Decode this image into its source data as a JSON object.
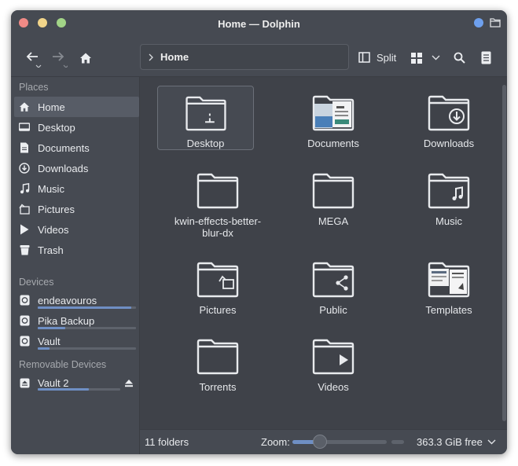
{
  "window": {
    "title": "Home — Dolphin"
  },
  "toolbar": {
    "back_icon": "arrow-left-icon",
    "forward_icon": "arrow-right-icon",
    "home_icon": "home-icon",
    "breadcrumb": [
      "Home"
    ],
    "split_label": "Split",
    "view_mode_icon": "grid-icon",
    "search_icon": "search-icon",
    "menu_icon": "hamburger-menu-icon"
  },
  "sidebar": {
    "places_title": "Places",
    "places": [
      {
        "label": "Home",
        "icon": "home-icon",
        "active": true
      },
      {
        "label": "Desktop",
        "icon": "desktop-icon"
      },
      {
        "label": "Documents",
        "icon": "document-icon"
      },
      {
        "label": "Downloads",
        "icon": "download-icon"
      },
      {
        "label": "Music",
        "icon": "music-note-icon"
      },
      {
        "label": "Pictures",
        "icon": "picture-icon"
      },
      {
        "label": "Videos",
        "icon": "play-icon"
      },
      {
        "label": "Trash",
        "icon": "trash-icon"
      }
    ],
    "devices_title": "Devices",
    "devices": [
      {
        "label": "endeavouros",
        "icon": "disk-icon",
        "usage": 0.95
      },
      {
        "label": "Pika Backup",
        "icon": "disk-icon",
        "usage": 0.28
      },
      {
        "label": "Vault",
        "icon": "disk-icon",
        "usage": 0.12
      }
    ],
    "removable_title": "Removable Devices",
    "removable": [
      {
        "label": "Vault 2",
        "icon": "drive-eject-icon",
        "usage": 0.62
      }
    ]
  },
  "files": [
    {
      "label": "Desktop",
      "icon": "folder-desktop-icon",
      "selected": true
    },
    {
      "label": "Documents",
      "icon": "folder-documents-icon"
    },
    {
      "label": "Downloads",
      "icon": "folder-downloads-icon"
    },
    {
      "label": "kwin-effects-better-blur-dx",
      "icon": "folder-icon"
    },
    {
      "label": "MEGA",
      "icon": "folder-icon"
    },
    {
      "label": "Music",
      "icon": "folder-music-icon"
    },
    {
      "label": "Pictures",
      "icon": "folder-pictures-icon"
    },
    {
      "label": "Public",
      "icon": "folder-public-icon"
    },
    {
      "label": "Templates",
      "icon": "folder-templates-icon"
    },
    {
      "label": "Torrents",
      "icon": "folder-icon"
    },
    {
      "label": "Videos",
      "icon": "folder-videos-icon"
    }
  ],
  "statusbar": {
    "count": "11 folders",
    "zoom_label": "Zoom:",
    "free_space": "363.3 GiB free"
  },
  "colors": {
    "window_bg": "#464a52",
    "view_bg": "#3f4249",
    "accent": "#6f8fc4",
    "text": "#e9ebee"
  }
}
